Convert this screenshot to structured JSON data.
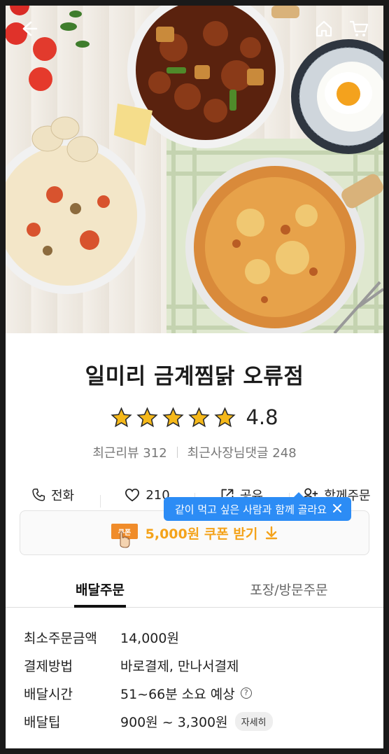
{
  "header": {
    "back_icon": "arrow-left-icon",
    "home_icon": "home-icon",
    "cart_icon": "cart-icon"
  },
  "store": {
    "name": "일미리 금계찜닭 오류점",
    "rating": "4.8",
    "rating_stars": 5,
    "recent_reviews": "최근리뷰 312",
    "owner_replies": "최근사장님댓글 248"
  },
  "actions": [
    {
      "label": "전화",
      "icon": "phone-icon"
    },
    {
      "label": "210",
      "icon": "heart-icon"
    },
    {
      "label": "공유",
      "icon": "share-icon"
    },
    {
      "label": "함께주문",
      "icon": "add-user-icon"
    }
  ],
  "tooltip": {
    "text": "같이 먹고 싶은 사람과 함께 골라요",
    "close_icon": "close-icon"
  },
  "coupon": {
    "badge": "쿠폰",
    "text": "5,000원 쿠폰 받기",
    "icon": "download-arrow-icon"
  },
  "tabs": [
    {
      "label": "배달주문",
      "active": true
    },
    {
      "label": "포장/방문주문",
      "active": false
    }
  ],
  "info": {
    "min_order": {
      "label": "최소주문금액",
      "value": "14,000원"
    },
    "payment": {
      "label": "결제방법",
      "value": "바로결제, 만나서결제"
    },
    "delivery_time": {
      "label": "배달시간",
      "value": "51~66분 소요 예상"
    },
    "delivery_tip": {
      "label": "배달팁",
      "value": "900원 ~ 3,300원",
      "detail": "자세히"
    }
  },
  "colors": {
    "star": "#f5b819",
    "coupon": "#f4a31b",
    "tooltip": "#2c8cf5",
    "tab_active": "#111111"
  }
}
